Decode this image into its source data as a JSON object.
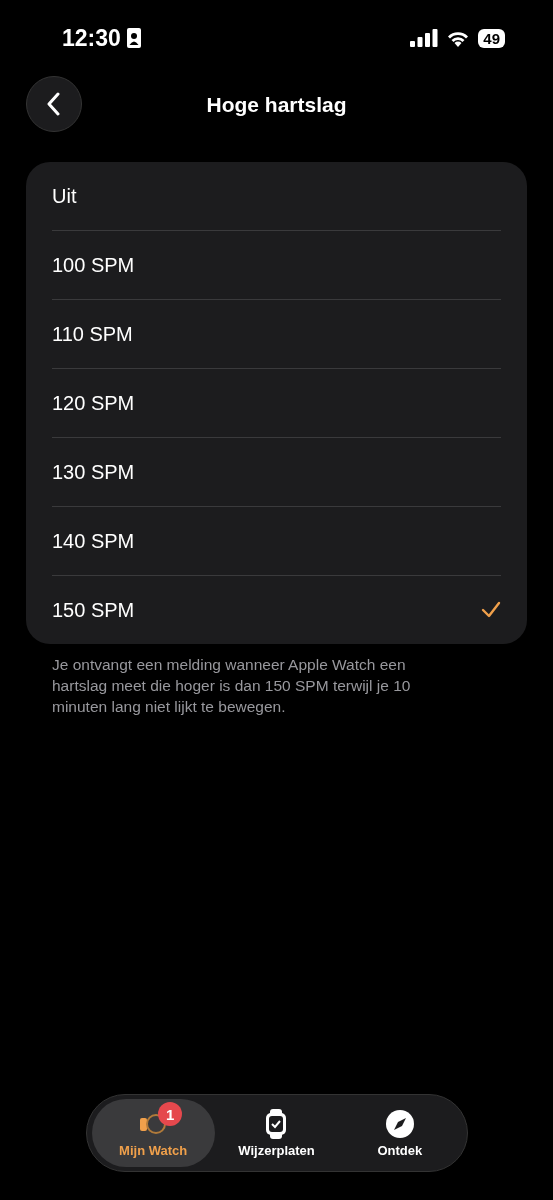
{
  "status_bar": {
    "time": "12:30",
    "battery": "49"
  },
  "nav": {
    "title": "Hoge hartslag"
  },
  "options": [
    {
      "label": "Uit",
      "selected": false
    },
    {
      "label": "100 SPM",
      "selected": false
    },
    {
      "label": "110 SPM",
      "selected": false
    },
    {
      "label": "120 SPM",
      "selected": false
    },
    {
      "label": "130 SPM",
      "selected": false
    },
    {
      "label": "140 SPM",
      "selected": false
    },
    {
      "label": "150 SPM",
      "selected": true
    }
  ],
  "footer": "Je ontvangt een melding wanneer Apple Watch een hartslag meet die hoger is dan 150 SPM terwijl je 10 minuten lang niet lijkt te bewegen.",
  "tab_bar": [
    {
      "kind": "watch",
      "label": "Mijn Watch",
      "selected": true,
      "badge": "1"
    },
    {
      "kind": "face",
      "label": "Wijzerplaten",
      "selected": false
    },
    {
      "kind": "compass",
      "label": "Ontdek",
      "selected": false
    }
  ]
}
